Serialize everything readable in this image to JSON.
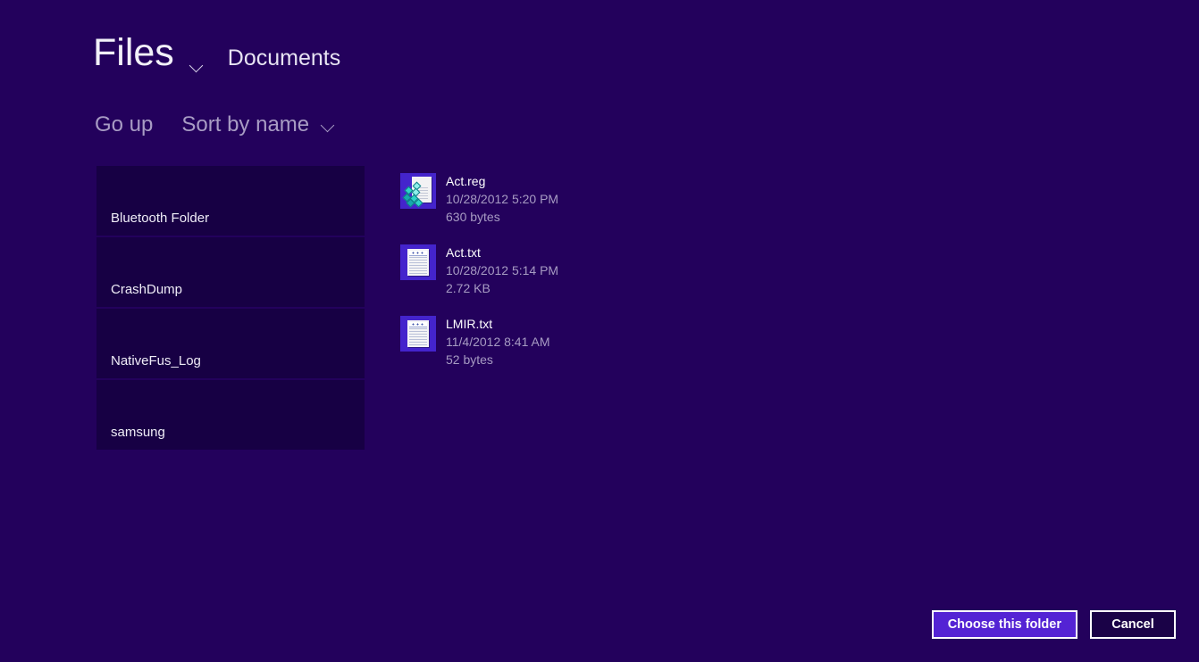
{
  "header": {
    "app_title": "Files",
    "title_chevron_icon": "chevron-down-icon",
    "breadcrumb_current": "Documents"
  },
  "commandbar": {
    "go_up_label": "Go up",
    "sort_label": "Sort by name",
    "sort_chevron_icon": "chevron-down-icon"
  },
  "folders": [
    {
      "name": "Bluetooth Folder"
    },
    {
      "name": "CrashDump"
    },
    {
      "name": "NativeFus_Log"
    },
    {
      "name": "samsung"
    }
  ],
  "files": [
    {
      "name": "Act.reg",
      "date": "10/28/2012 5:20 PM",
      "size": "630 bytes",
      "icon": "registry-file-icon"
    },
    {
      "name": "Act.txt",
      "date": "10/28/2012 5:14 PM",
      "size": "2.72 KB",
      "icon": "text-file-icon"
    },
    {
      "name": "LMIR.txt",
      "date": "11/4/2012 8:41 AM",
      "size": "52 bytes",
      "icon": "text-file-icon"
    }
  ],
  "footer": {
    "choose_label": "Choose this folder",
    "cancel_label": "Cancel"
  },
  "colors": {
    "background": "#23015c",
    "tile": "#170044",
    "accent": "#5423d4",
    "primary_text": "#f2f0f8",
    "muted_text": "#a79bc3",
    "button_border": "#ffffff",
    "cancel_fill": "#1a0247"
  }
}
